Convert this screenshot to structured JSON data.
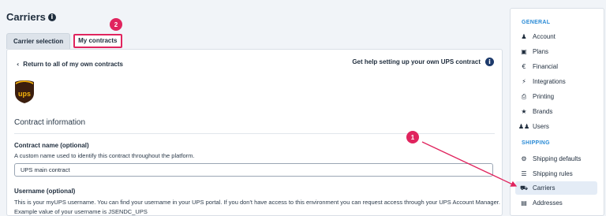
{
  "page": {
    "title": "Carriers"
  },
  "tabs": [
    {
      "label": "Carrier selection"
    },
    {
      "label": "My contracts"
    }
  ],
  "content": {
    "back_link": "Return to all of my own contracts",
    "help_link": "Get help setting up your own UPS contract",
    "logo_text": "ups",
    "section_title": "Contract information",
    "contract_name_label": "Contract name (optional)",
    "contract_name_help": "A custom name used to identify this contract throughout the platform.",
    "contract_name_value": "UPS main contract",
    "username_label": "Username (optional)",
    "username_help": "This is your myUPS username. You can find your username in your UPS portal. If you don't have access to this environment you can request access through your UPS Account Manager.",
    "username_example": "Example value of your username is JSENDC_UPS"
  },
  "sidebar": {
    "general_heading": "GENERAL",
    "general_items": [
      {
        "label": "Account",
        "icon": "user-icon"
      },
      {
        "label": "Plans",
        "icon": "plans-icon"
      },
      {
        "label": "Financial",
        "icon": "euro-icon"
      },
      {
        "label": "Integrations",
        "icon": "plug-icon"
      },
      {
        "label": "Printing",
        "icon": "printer-icon"
      },
      {
        "label": "Brands",
        "icon": "star-icon"
      },
      {
        "label": "Users",
        "icon": "users-icon"
      }
    ],
    "shipping_heading": "SHIPPING",
    "shipping_items": [
      {
        "label": "Shipping defaults",
        "icon": "gear-icon"
      },
      {
        "label": "Shipping rules",
        "icon": "rules-icon"
      },
      {
        "label": "Carriers",
        "icon": "truck-icon",
        "active": true
      },
      {
        "label": "Addresses",
        "icon": "address-icon"
      }
    ]
  },
  "annotations": {
    "badge_1": "1",
    "badge_2": "2",
    "color": "#e0245e"
  }
}
